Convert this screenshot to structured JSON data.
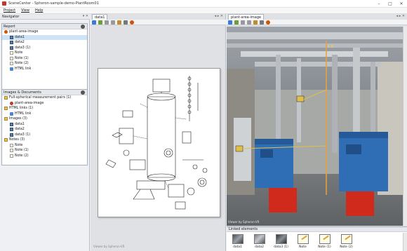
{
  "window": {
    "title": "SceneCenter - Spheron-sample-demo-PlantRoom01"
  },
  "menu": [
    "Project",
    "View",
    "Help"
  ],
  "navigator": {
    "title": "Navigator",
    "report_header": "Report",
    "report_tree": [
      {
        "label": "plant-area-image",
        "icon": "plant-icon",
        "indent": 0
      },
      {
        "label": "data1",
        "icon": "image-icon",
        "indent": 1,
        "selected": true
      },
      {
        "label": "data2",
        "icon": "image-icon",
        "indent": 1
      },
      {
        "label": "data3 (1)",
        "icon": "image-icon",
        "indent": 1
      },
      {
        "label": "Note",
        "icon": "note-icon",
        "indent": 1
      },
      {
        "label": "Note (1)",
        "icon": "note-icon",
        "indent": 1
      },
      {
        "label": "Note (2)",
        "icon": "note-icon",
        "indent": 1
      },
      {
        "label": "HTML link",
        "icon": "link-icon",
        "indent": 1
      }
    ],
    "images_header": "Images & Documents",
    "images_tree": [
      {
        "label": "Full-spherical measurement pairs (1)",
        "icon": "folder-icon",
        "indent": 0
      },
      {
        "label": "plant-area-image",
        "icon": "sphere-icon",
        "indent": 1
      },
      {
        "label": "HTML links (1)",
        "icon": "folder-icon",
        "indent": 0
      },
      {
        "label": "HTML link",
        "icon": "link-icon",
        "indent": 1
      },
      {
        "label": "Images (3)",
        "icon": "folder-icon",
        "indent": 0
      },
      {
        "label": "data1",
        "icon": "image-icon",
        "indent": 1
      },
      {
        "label": "data2",
        "icon": "image-icon",
        "indent": 1
      },
      {
        "label": "data3 (1)",
        "icon": "image-icon",
        "indent": 1
      },
      {
        "label": "Notes (3)",
        "icon": "folder-icon",
        "indent": 0
      },
      {
        "label": "Note",
        "icon": "note-icon",
        "indent": 1
      },
      {
        "label": "Note (1)",
        "icon": "note-icon",
        "indent": 1
      },
      {
        "label": "Note (2)",
        "icon": "note-icon",
        "indent": 1
      }
    ]
  },
  "doc_panel": {
    "tab": "data1",
    "viewer_caption": "Viewer by Spheron-VR"
  },
  "img_panel": {
    "tab": "plant-area-image",
    "measure_value": "1.5",
    "viewer_caption": "Viewer by Spheron-VR",
    "linked_title": "Linked elements",
    "linked": [
      {
        "label": "data1",
        "kind": "photo1"
      },
      {
        "label": "data2",
        "kind": "photo2"
      },
      {
        "label": "data3 (1)",
        "kind": "photo3"
      },
      {
        "label": "Note",
        "kind": "note"
      },
      {
        "label": "Note (1)",
        "kind": "note"
      },
      {
        "label": "Note (2)",
        "kind": "note"
      }
    ]
  },
  "colors": {
    "accent": "#c0392b",
    "selection": "#cfe3f7",
    "pipe_orange": "#d98a2b",
    "boiler_blue": "#2f6db5"
  }
}
